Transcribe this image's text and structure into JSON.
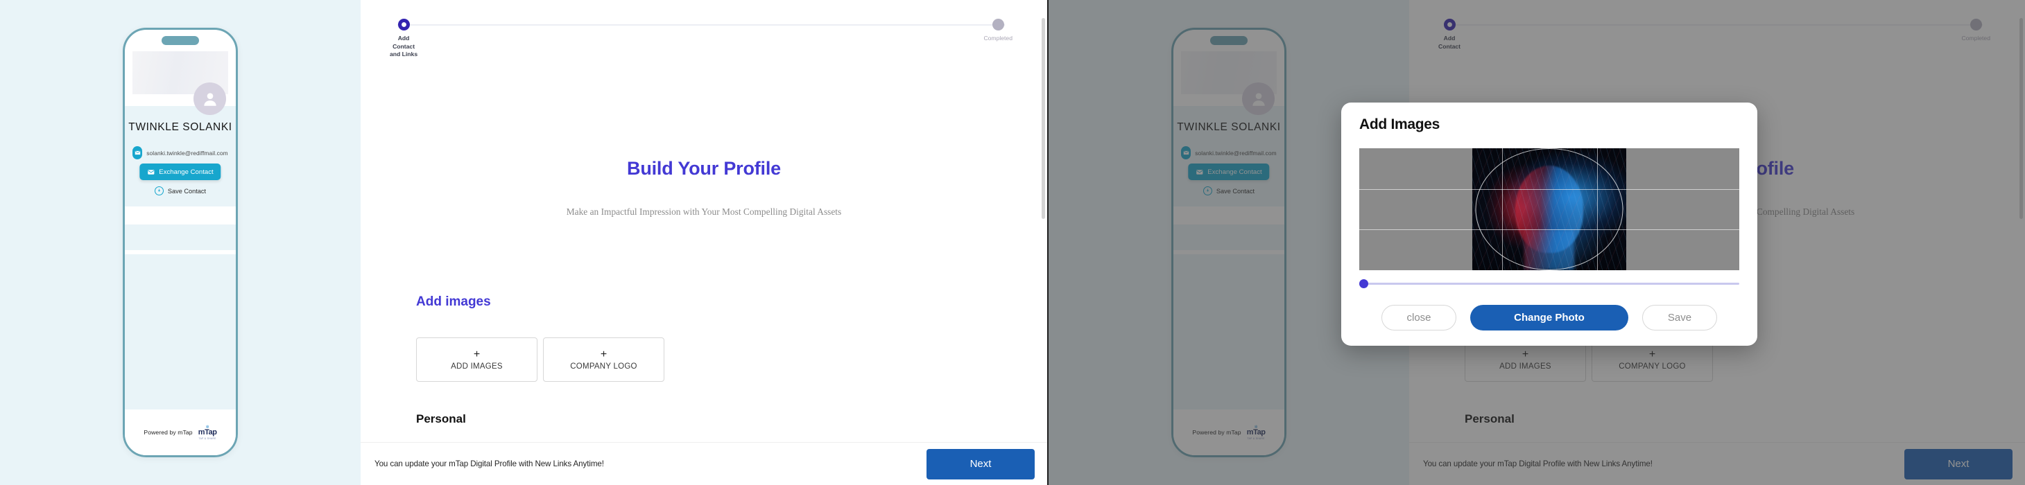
{
  "profile_card": {
    "name": "TWINKLE SOLANKI",
    "email": "solanki.twinkle@rediffmail.com",
    "exchange_button": "Exchange Contact",
    "save_contact": "Save Contact",
    "powered_by": "Powered by mTap",
    "logo_word": "mTap",
    "logo_tagline": "TAP & SHARE",
    "icons": {
      "avatar": "person-icon",
      "mail": "envelope-icon",
      "download": "download-arrow-icon"
    }
  },
  "stepper": {
    "steps": [
      {
        "label": "Add\nContact\nand Links",
        "state": "active"
      },
      {
        "label": "Completed",
        "state": "idle"
      }
    ],
    "active_color": "#3323b0",
    "idle_color": "#b3b1c1"
  },
  "main": {
    "title": "Build Your Profile",
    "subtitle": "Make an Impactful Impression with Your Most Compelling Digital Assets",
    "sections": {
      "add_images_heading": "Add images",
      "personal_heading": "Personal"
    },
    "image_buttons": [
      {
        "plus": "+",
        "label": "ADD IMAGES"
      },
      {
        "plus": "+",
        "label": "COMPANY LOGO"
      }
    ],
    "accent_color": "#4339d4"
  },
  "bottom_bar": {
    "note": "You can update your mTap Digital Profile with New Links Anytime!",
    "next_label": "Next",
    "next_color": "#1a5fb4"
  },
  "modal": {
    "title": "Add Images",
    "slider_value": 0,
    "buttons": {
      "close": "close",
      "change_photo": "Change Photo",
      "save": "Save"
    },
    "primary_color": "#1a5fb4",
    "knob_color": "#4339d4"
  },
  "stepper_right": {
    "steps": [
      {
        "label": "Add\nContact",
        "state": "active"
      },
      {
        "label": "Completed",
        "state": "idle"
      }
    ]
  }
}
